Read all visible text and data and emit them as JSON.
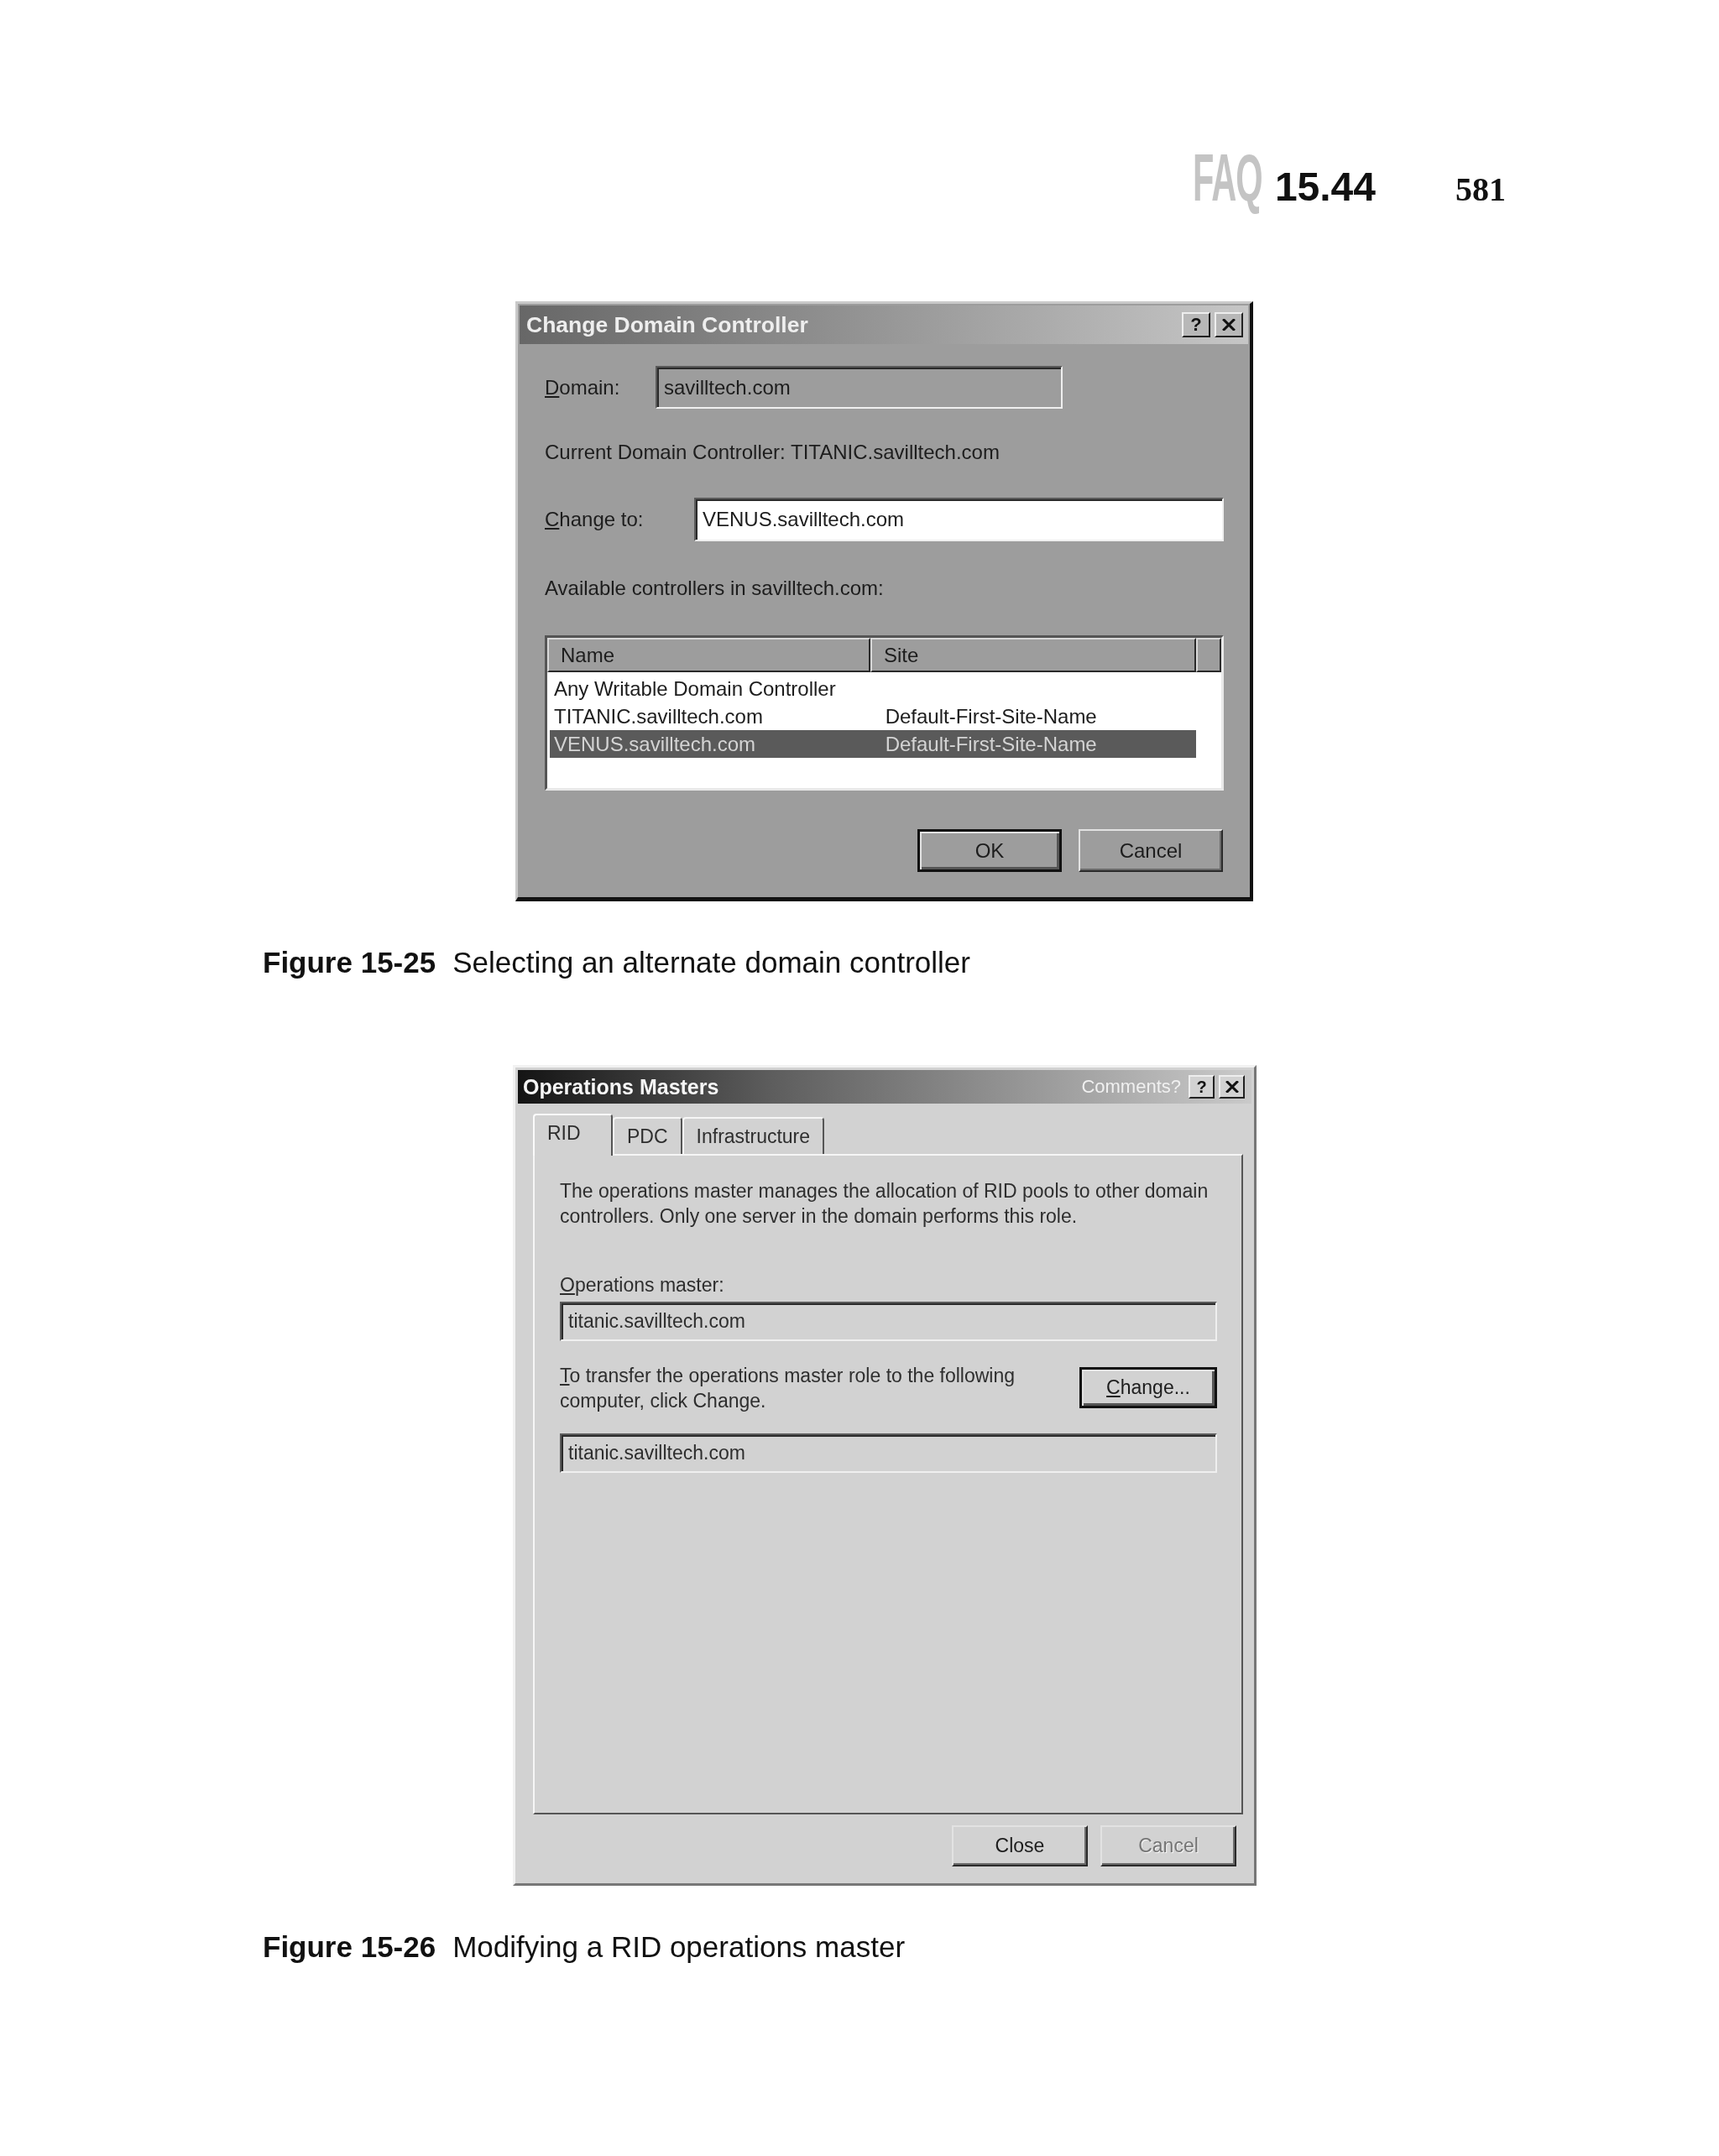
{
  "page_header": {
    "logo": "FAQ",
    "section": "15.44",
    "page_number": "581"
  },
  "change_domain_controller": {
    "title": "Change Domain Controller",
    "help_button": "?",
    "domain": {
      "label": "Domain:",
      "value": "savilltech.com",
      "disabled": true
    },
    "current_controller": "Current Domain Controller: TITANIC.savilltech.com",
    "change_to": {
      "label": "Change to:",
      "value": "VENUS.savilltech.com",
      "disabled": false
    },
    "available_label": "Available controllers in savilltech.com:",
    "controllers": {
      "columns": [
        "Name",
        "Site"
      ],
      "rows": [
        {
          "name": "Any Writable Domain Controller",
          "selected": false
        },
        {
          "name": "TITANIC.savilltech.com",
          "site": "Default-First-Site-Name",
          "selected": false
        },
        {
          "name": "VENUS.savilltech.com",
          "site": "Default-First-Site-Name",
          "selected": true
        }
      ]
    },
    "buttons": [
      {
        "label": "OK",
        "default": true,
        "disabled": false
      },
      {
        "label": "Cancel",
        "default": false,
        "disabled": false
      }
    ]
  },
  "caption_1": {
    "number": "Figure 15-25",
    "text": "Selecting an alternate domain controller"
  },
  "operations_masters": {
    "title": "Operations Masters",
    "comments_link": "Comments?",
    "help_button": "?",
    "tabs": [
      {
        "label": "RID",
        "selected": true
      },
      {
        "label": "PDC",
        "selected": false
      },
      {
        "label": "Infrastructure",
        "selected": false
      }
    ],
    "description": "The operations master manages the allocation of RID pools to other domain controllers. Only one server in the domain performs this role.",
    "operations_master": {
      "label": "Operations master:",
      "value": "titanic.savilltech.com",
      "disabled": true
    },
    "transfer_text": "To transfer the operations master role to the following computer, click Change.",
    "change_button": {
      "label": "Change...",
      "default": true,
      "disabled": false
    },
    "target": {
      "value": "titanic.savilltech.com",
      "disabled": true
    },
    "buttons": [
      {
        "label": "Close",
        "default": false,
        "disabled": false
      },
      {
        "label": "Cancel",
        "default": false,
        "disabled": true
      }
    ]
  },
  "caption_2": {
    "number": "Figure 15-26",
    "text": "Modifying a RID operations master"
  }
}
